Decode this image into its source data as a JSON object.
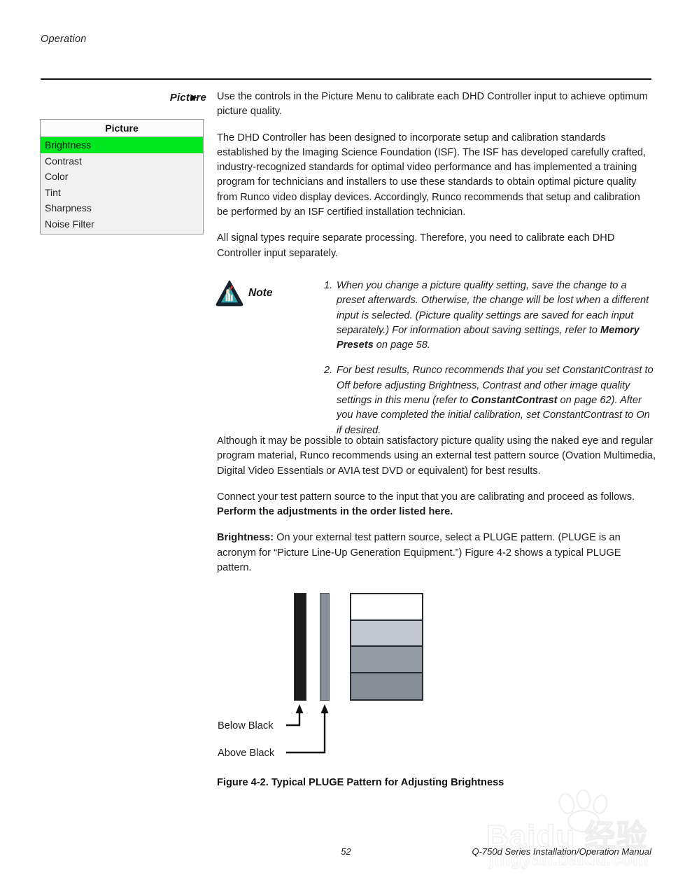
{
  "header": {
    "running_head": "Operation"
  },
  "side_heading": {
    "label": "Picture",
    "arrow": "➤"
  },
  "osd_menu": {
    "title": "Picture",
    "selected_index": 0,
    "highlight_color": "#00e81f",
    "items": [
      {
        "label": "Brightness"
      },
      {
        "label": "Contrast"
      },
      {
        "label": "Color"
      },
      {
        "label": "Tint"
      },
      {
        "label": "Sharpness"
      },
      {
        "label": "Noise Filter"
      }
    ]
  },
  "body": {
    "paragraph_1": "Use the controls in the Picture Menu to calibrate each DHD Controller input to achieve optimum picture quality.",
    "paragraph_2": "The DHD Controller has been designed to incorporate setup and calibration standards established by the Imaging Science Foundation (ISF). The ISF has developed carefully crafted, industry-recognized standards for optimal video performance and has implemented a training program for technicians and installers to use these standards to obtain optimal picture quality from Runco video display devices. Accordingly, Runco recommends that setup and calibration be performed by an ISF certified installation technician.",
    "paragraph_3": "All signal types require separate processing. Therefore, you need to calibrate each DHD Controller input separately."
  },
  "note": {
    "label": "Note",
    "icon": "note-triangle-hand-icon",
    "items": [
      {
        "number": "1.",
        "text_before": "When you change a picture quality setting, save the change to a preset afterwards. Otherwise, the change will be lost when a different input is selected. (Picture quality settings are saved for each input separately.) For information about saving settings, refer to ",
        "bold": "Memory Presets",
        "text_after": " on page 58."
      },
      {
        "number": "2.",
        "text_before": "For best results, Runco recommends that you set ConstantContrast to Off before adjusting Brightness, Contrast and other image quality settings in this menu (refer to ",
        "bold": "ConstantContrast",
        "text_after": " on page 62). After you have completed the initial calibration, set ConstantContrast to On if desired."
      }
    ]
  },
  "lower": {
    "paragraph_4": "Although it may be possible to obtain satisfactory picture quality using the naked eye and regular program material, Runco recommends using an external test pattern source (Ovation Multimedia, Digital Video Essentials or AVIA test DVD or equivalent) for best results.",
    "paragraph_5_text": "Connect your test pattern source to the input that you are calibrating and proceed as follows. ",
    "paragraph_5_bold": "Perform the adjustments in the order listed here.",
    "paragraph_6_bold": "Brightness:",
    "paragraph_6_text": " On your external test pattern source, select a PLUGE pattern. (PLUGE is an acronym for “Picture Line-Up Generation Equipment.”) Figure 4-2 shows a typical PLUGE pattern."
  },
  "figure": {
    "caption": "Figure 4-2. Typical PLUGE Pattern for Adjusting Brightness",
    "callout_below_black": "Below Black",
    "callout_above_black": "Above Black",
    "bar_below_black_color": "#1c1c1c",
    "bar_above_black_color": "#8b919b",
    "stack_bands": [
      {
        "name": "white-band",
        "color": "#ffffff"
      },
      {
        "name": "light-gray-band",
        "color": "#c3c8d0"
      },
      {
        "name": "medium-gray-band",
        "color": "#959ba5"
      },
      {
        "name": "dark-gray-band",
        "color": "#888e97"
      }
    ]
  },
  "footer": {
    "page_number": "52",
    "manual_title": "Q-750d Series Installation/Operation Manual"
  },
  "watermark": {
    "main": "Baidu 经验",
    "sub": "jingyan.baidu.com"
  }
}
